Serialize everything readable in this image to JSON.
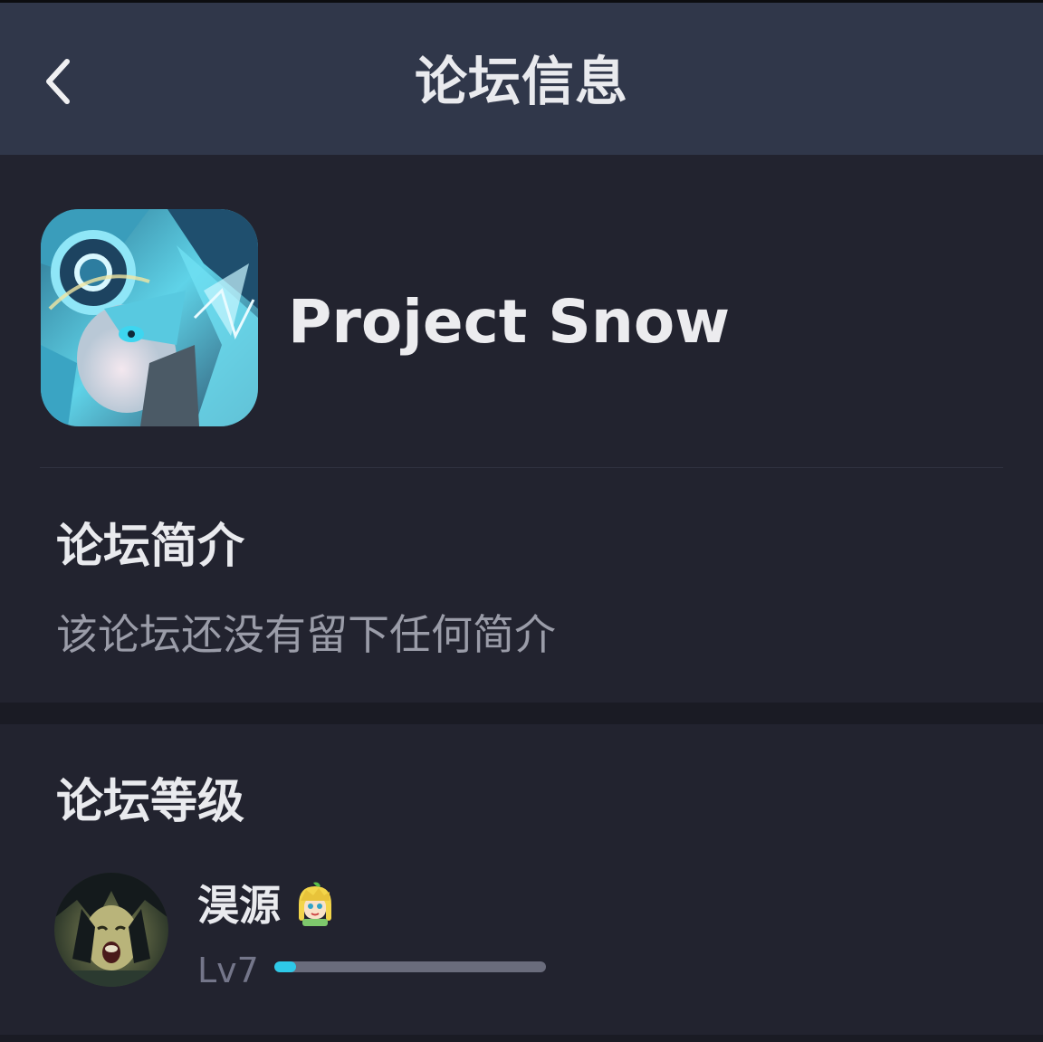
{
  "header": {
    "title": "论坛信息",
    "back_icon": "chevron-left-icon"
  },
  "forum": {
    "name": "Project Snow",
    "icon": "forum-logo"
  },
  "intro": {
    "title": "论坛简介",
    "text": "该论坛还没有留下任何简介"
  },
  "level": {
    "title": "论坛等级",
    "user": {
      "name": "淏源",
      "badge_icon": "emoji-badge-icon",
      "level_label": "Lv7",
      "progress": 0.08
    }
  },
  "colors": {
    "header_bg": "#30374a",
    "page_bg": "#1a1b24",
    "card_bg": "#22232f",
    "accent": "#2ec9e8"
  }
}
